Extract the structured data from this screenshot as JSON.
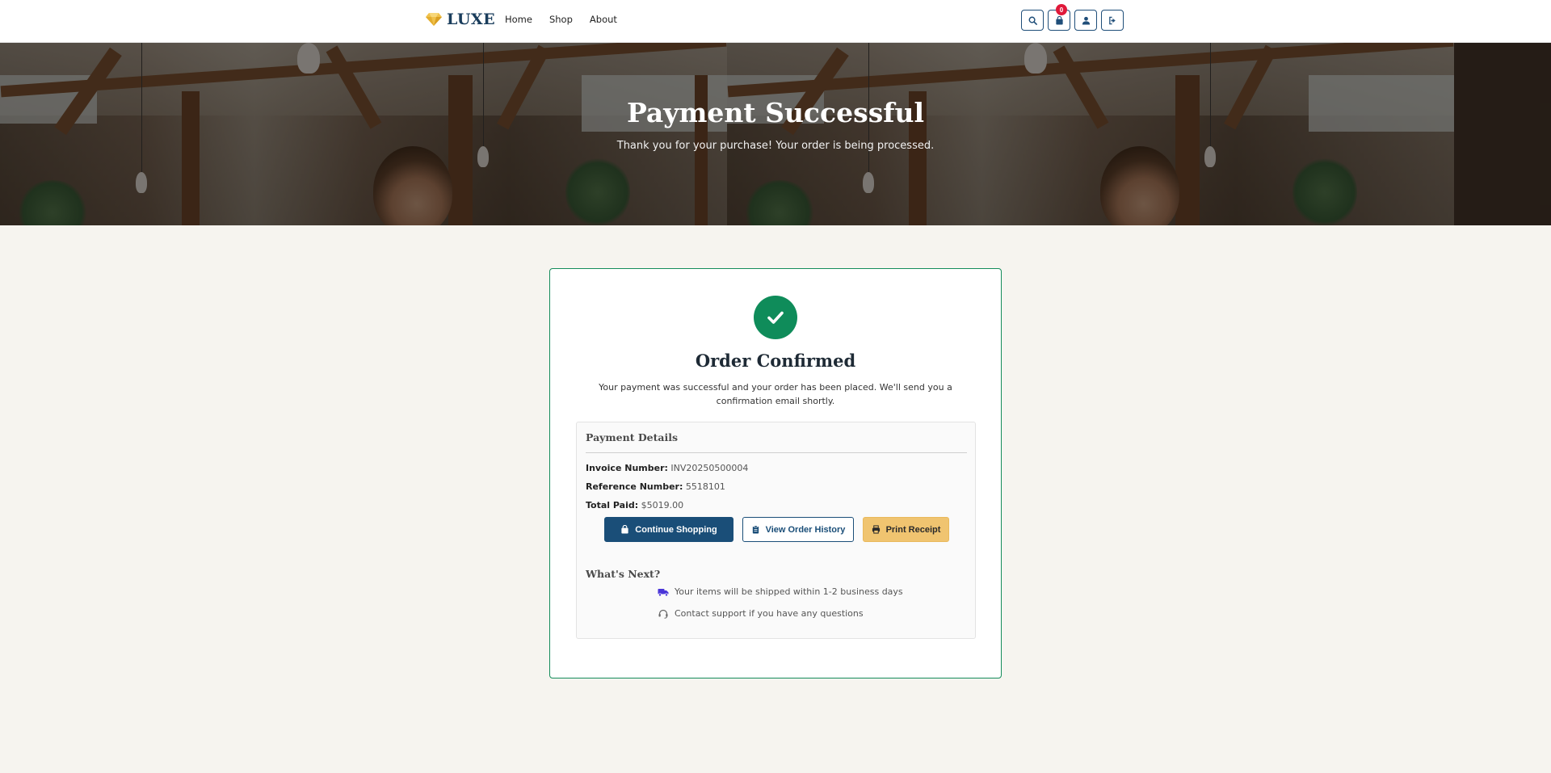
{
  "brand": {
    "name": "LUXE",
    "accent_color": "#1a3d5c",
    "gem_color": "#f0c14b"
  },
  "nav": {
    "links": [
      "Home",
      "Shop",
      "About"
    ],
    "icons": [
      "search-icon",
      "cart-icon",
      "user-icon",
      "logout-icon"
    ],
    "cart_count": "0"
  },
  "hero": {
    "title": "Payment Successful",
    "subtitle": "Thank you for your purchase! Your order is being processed."
  },
  "card": {
    "title": "Order Confirmed",
    "message": "Your payment was successful and your order has been placed. We'll send you a confirmation email shortly.",
    "status_color": "#0f8c5a"
  },
  "payment_details": {
    "title": "Payment Details",
    "invoice_label": "Invoice Number:",
    "invoice_value": "INV20250500004",
    "reference_label": "Reference Number:",
    "reference_value": "5518101",
    "total_label": "Total Paid:",
    "total_value": "$5019.00"
  },
  "actions": {
    "continue_label": "Continue Shopping",
    "history_label": "View Order History",
    "print_label": "Print Receipt"
  },
  "whats_next": {
    "title": "What's Next?",
    "items": [
      {
        "icon": "truck-icon",
        "text": "Your items will be shipped within 1-2 business days"
      },
      {
        "icon": "headset-icon",
        "text": "Contact support if you have any questions"
      }
    ]
  }
}
